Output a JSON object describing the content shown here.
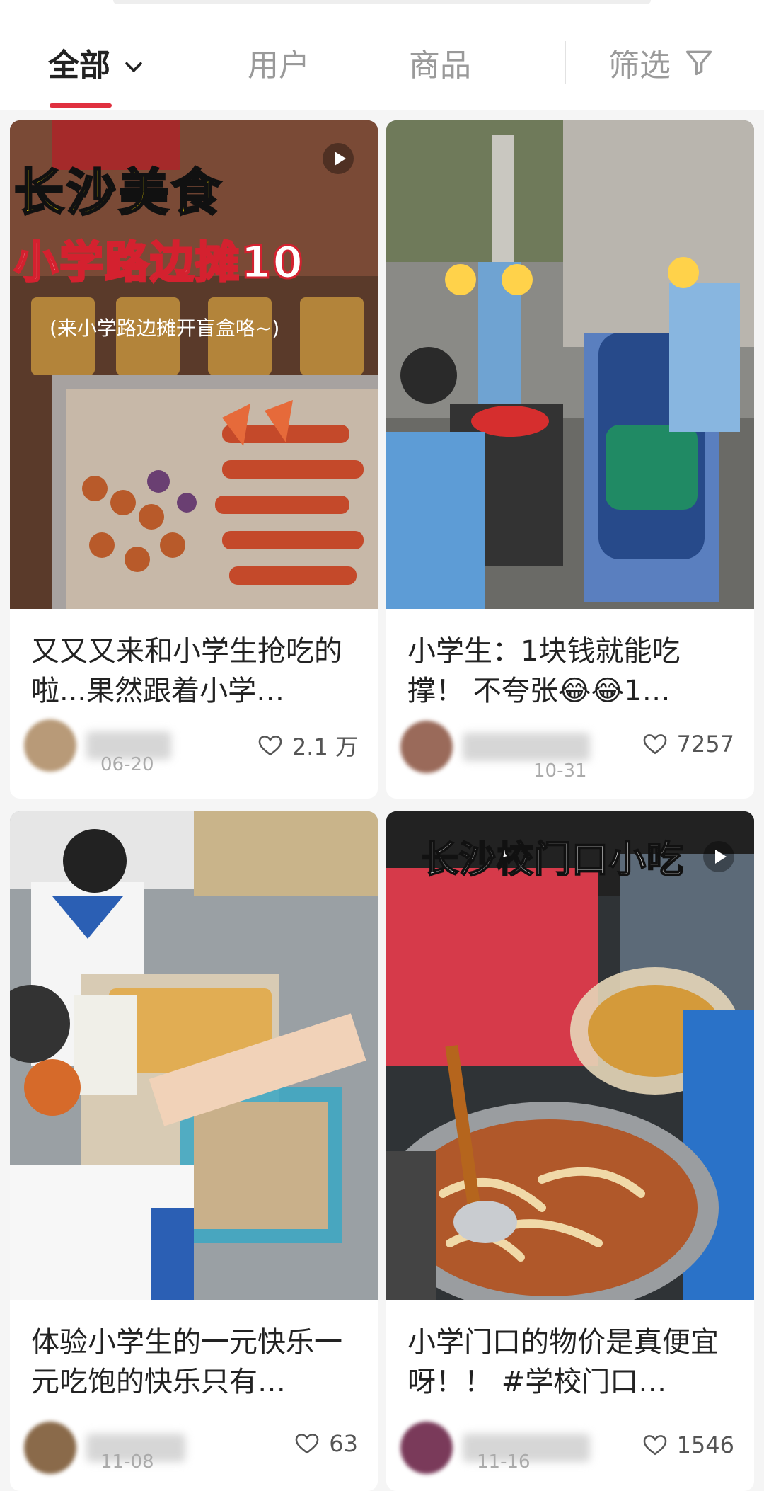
{
  "tabs": [
    {
      "label": "全部",
      "active": true
    },
    {
      "label": "用户",
      "active": false
    },
    {
      "label": "商品",
      "active": false
    },
    {
      "label": "筛选",
      "active": false
    }
  ],
  "colors": {
    "accent": "#e0303f"
  },
  "posts": [
    {
      "overlay_title": "长沙美食",
      "overlay_subtitle": "小学路边摊10",
      "overlay_caption": "(来小学路边摊开盲盒咯~)",
      "title": "又又又来和小学生抢吃的啦...果然跟着小学…",
      "date": "06-20",
      "likes": "2.1 万",
      "has_video": true
    },
    {
      "title": "小学生：1块钱就能吃撑！ 不夸张😂😂1…",
      "date": "10-31",
      "likes": "7257",
      "has_video": false
    },
    {
      "title": "体验小学生的一元快乐一元吃饱的快乐只有…",
      "date": "11-08",
      "likes": "63",
      "has_video": false
    },
    {
      "overlay_title": "长沙校门口小吃",
      "title": "小学门口的物价是真便宜呀！！ #学校门口…",
      "date": "11-16",
      "likes": "1546",
      "has_video": true
    }
  ]
}
